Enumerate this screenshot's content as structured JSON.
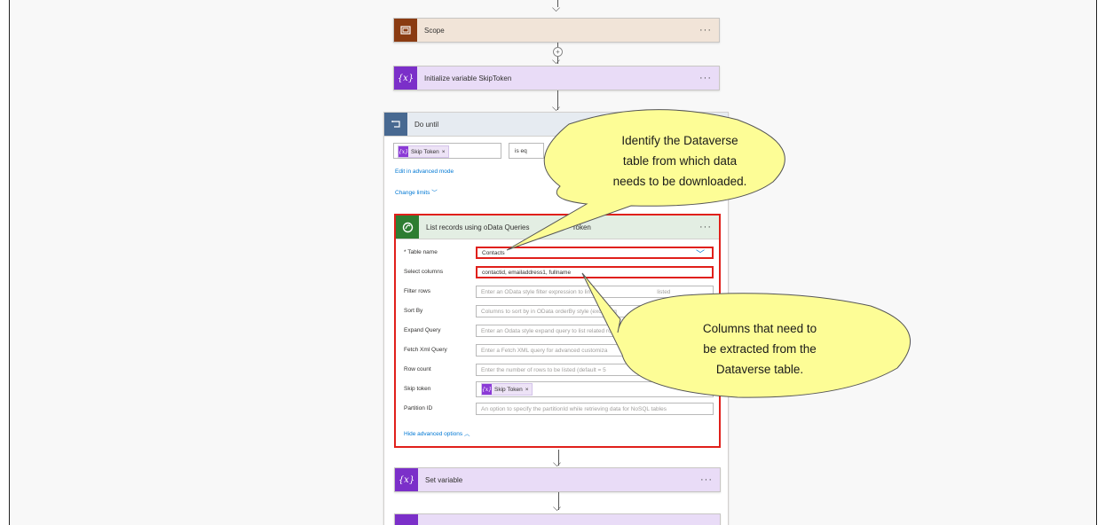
{
  "flow": {
    "scope": {
      "title": "Scope",
      "more": "···",
      "color": "#8a3b12"
    },
    "init_var": {
      "title": "Initialize variable SkipToken",
      "more": "···",
      "icon": "{x}",
      "color": "#7b2fc9"
    },
    "do_until": {
      "title": "Do until",
      "condition_token": "Skip Token",
      "condition_operator": "is eq",
      "edit_advanced": "Edit in advanced mode",
      "change_limits": "Change limits"
    },
    "list_records": {
      "title": "List records using oData Queries",
      "title_tail": "Token",
      "more": "···",
      "fields": [
        {
          "label": "* Table name",
          "value": "Contacts",
          "placeholder": ""
        },
        {
          "label": "Select columns",
          "value": "contactid, emailaddress1, fullname",
          "placeholder": ""
        },
        {
          "label": "Filter rows",
          "value": "",
          "placeholder": "Enter an OData style filter expression to limit"
        },
        {
          "label": "Sort By",
          "value": "",
          "placeholder": "Columns to sort by in OData orderBy style (excluding"
        },
        {
          "label": "Expand Query",
          "value": "",
          "placeholder": "Enter an Odata style expand query to list related rows"
        },
        {
          "label": "Fetch Xml Query",
          "value": "",
          "placeholder": "Enter a Fetch XML query for advanced customiza"
        },
        {
          "label": "Row count",
          "value": "",
          "placeholder": "Enter the number of rows to be listed (default = 5"
        },
        {
          "label": "Skip token",
          "value": "Skip Token",
          "placeholder": ""
        },
        {
          "label": "Partition ID",
          "value": "",
          "placeholder": "An option to specify the partitionId while retrieving data for NoSQL tables"
        }
      ],
      "filter_suffix": "listed",
      "hide_advanced": "Hide advanced options"
    },
    "set_variable": {
      "title": "Set variable",
      "more": "···"
    }
  },
  "callouts": {
    "table": [
      "Identify the Dataverse",
      "table from which data",
      "needs to be downloaded."
    ],
    "columns": [
      "Columns that need to",
      "be extracted from the",
      "Dataverse table."
    ],
    "fill": "#fdfd96"
  },
  "colors": {
    "highlight": "#e0201b",
    "dataverse": "#2e7d32",
    "variable": "#7b2fc9"
  }
}
